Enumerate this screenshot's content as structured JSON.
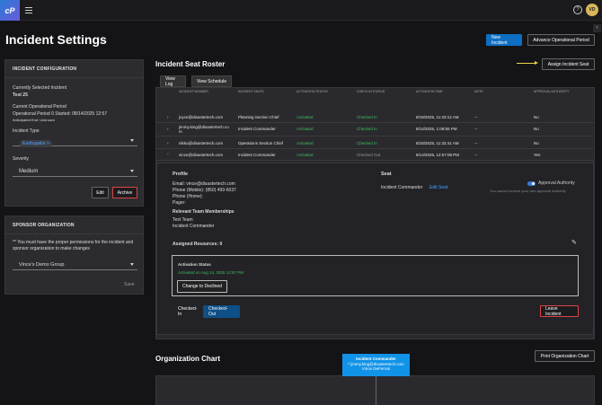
{
  "topbar": {
    "logo": "cP",
    "help_icon": "?",
    "avatar_initials": "VD"
  },
  "page": {
    "title": "Incident Settings"
  },
  "header_buttons": {
    "new_incident": "New Incident",
    "advance_period": "Advance Operational Period"
  },
  "config": {
    "heading": "INCIDENT CONFIGURATION",
    "selected_label": "Currently Selected Incident",
    "selected_value": "Test 25",
    "period_label": "Current Operational Period",
    "period_value": "Operational Period 0 Started: 08/14/2025 12:57",
    "anticipated": "Anticipated End: Unknown",
    "type_label": "Incident Type",
    "type_chip": "Earthquake",
    "severity_label": "Severity",
    "severity_value": "Medium",
    "edit": "Edit",
    "archive": "Archive"
  },
  "sponsor": {
    "heading": "SPONSOR ORGANIZATION",
    "note": "** You must have the proper permissions for the incident and sponsor organization to make changes",
    "org": "Vince's Demo Group",
    "save": "Save"
  },
  "roster": {
    "title": "Incident Seat Roster",
    "view_log": "View Log",
    "view_schedule": "View Schedule",
    "assign": "Assign Incident Seat",
    "columns": [
      "INCIDENT MEMBER",
      "INCIDENT SEATS",
      "ACTIVATION STATUS",
      "CHECK-IN STATUS",
      "ACTIVATION TIME",
      "NOTE",
      "APPROVAL AUTHORITY"
    ],
    "rows": [
      {
        "member": "joyce@disastertech.com",
        "seat": "Planning Section Chief",
        "activation": "Activated",
        "checkin": "Checked In",
        "time": "8/18/2025, 11:33:12 AM",
        "note": "--",
        "approval": "No"
      },
      {
        "member": "jimmy.king@disastertech.co m",
        "seat": "Incident Commander",
        "activation": "Activated",
        "checkin": "Checked In",
        "time": "8/14/2025, 1:09:55 PM",
        "note": "--",
        "approval": "No"
      },
      {
        "member": "nikko@disastertech.com",
        "seat": "Operations Section Chief",
        "activation": "Activated",
        "checkin": "Checked In",
        "time": "8/18/2025, 11:32:41 AM",
        "note": "--",
        "approval": "No"
      },
      {
        "member": "vince@disastertech.com",
        "seat": "Incident Commander",
        "activation": "Activated",
        "checkin": "Checked Out",
        "time": "8/14/2025, 12:57:08 PM",
        "note": "--",
        "approval": "Yes"
      }
    ]
  },
  "detail": {
    "profile_title": "Profile",
    "email": "Email: vince@disastertech.com",
    "phone": "Phone (Mobile): (850) 499-6037",
    "phone_home": "Phone (Home):",
    "pager": "Pager:",
    "memberships_title": "Relevant Team Memberships",
    "team": "Test Team",
    "team_role": "Incident Commander",
    "assigned": "Assigned Resources: 0",
    "seat_title": "Seat",
    "seat_value": "Incident Commander",
    "edit_seat": "Edit Seat",
    "approval_authority": "Approval Authority",
    "approval_note": "You cannot remove your own approval authority",
    "activation_status_title": "Activation Status",
    "activation_text": "Activated on Aug 14, 2025 12:57 PM",
    "change_declined": "Change to Declined",
    "checked_in": "Checked-In",
    "checked_out": "Checked-Out",
    "leave": "Leave Incident"
  },
  "orgchart": {
    "title": "Organization Chart",
    "print": "Print Organization Chart",
    "node_title": "Incident Commander",
    "node_email": "* jimmy.king@disastertech.com",
    "node_name": "Vince DeFerrari"
  }
}
